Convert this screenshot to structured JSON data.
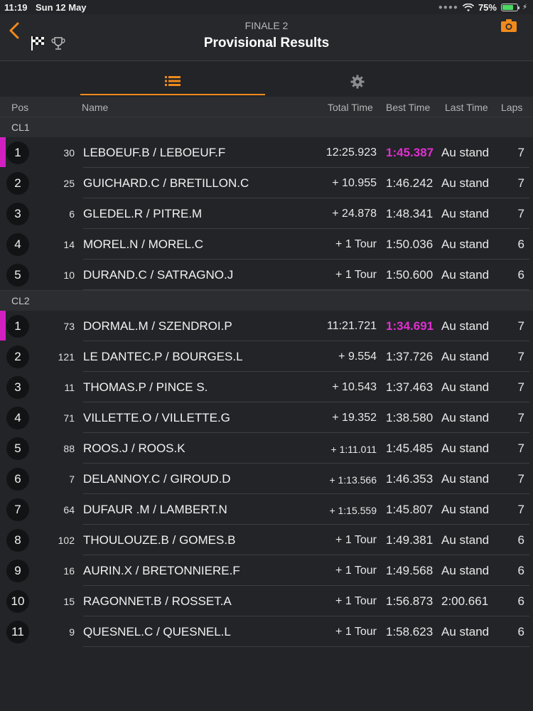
{
  "status": {
    "time": "11:19",
    "date": "Sun 12 May",
    "battery": "75%",
    "battery_level": 0.75
  },
  "header": {
    "subtitle": "FINALE 2",
    "title": "Provisional Results"
  },
  "columns": {
    "pos": "Pos",
    "name": "Name",
    "total": "Total Time",
    "best": "Best Time",
    "last": "Last Time",
    "laps": "Laps"
  },
  "colors": {
    "accent": "#f08a1c",
    "fastest": "#e02fd0",
    "leader_bar": "#d21fc0"
  },
  "classes": [
    {
      "label": "CL1",
      "rows": [
        {
          "pos": "1",
          "num": "30",
          "name": "LEBOEUF.B  / LEBOEUF.F",
          "total": "12:25.923",
          "best": "1:45.387",
          "last": "Au stand",
          "laps": "7",
          "fastest": true,
          "small": false
        },
        {
          "pos": "2",
          "num": "25",
          "name": "GUICHARD.C  / BRETILLON.C",
          "total": "+ 10.955",
          "best": "1:46.242",
          "last": "Au stand",
          "laps": "7",
          "fastest": false,
          "small": false
        },
        {
          "pos": "3",
          "num": "6",
          "name": "GLEDEL.R  / PITRE.M",
          "total": "+ 24.878",
          "best": "1:48.341",
          "last": "Au stand",
          "laps": "7",
          "fastest": false,
          "small": false
        },
        {
          "pos": "4",
          "num": "14",
          "name": "MOREL.N  / MOREL.C",
          "total": "+ 1 Tour",
          "best": "1:50.036",
          "last": "Au stand",
          "laps": "6",
          "fastest": false,
          "small": false
        },
        {
          "pos": "5",
          "num": "10",
          "name": "DURAND.C  / SATRAGNO.J",
          "total": "+ 1 Tour",
          "best": "1:50.600",
          "last": "Au stand",
          "laps": "6",
          "fastest": false,
          "small": false
        }
      ]
    },
    {
      "label": "CL2",
      "rows": [
        {
          "pos": "1",
          "num": "73",
          "name": "DORMAL.M  / SZENDROI.P",
          "total": "11:21.721",
          "best": "1:34.691",
          "last": "Au stand",
          "laps": "7",
          "fastest": true,
          "small": false
        },
        {
          "pos": "2",
          "num": "121",
          "name": "LE DANTEC.P  / BOURGES.L",
          "total": "+ 9.554",
          "best": "1:37.726",
          "last": "Au stand",
          "laps": "7",
          "fastest": false,
          "small": false
        },
        {
          "pos": "3",
          "num": "11",
          "name": "THOMAS.P  / PINCE S.",
          "total": "+ 10.543",
          "best": "1:37.463",
          "last": "Au stand",
          "laps": "7",
          "fastest": false,
          "small": false
        },
        {
          "pos": "4",
          "num": "71",
          "name": "VILLETTE.O  / VILLETTE.G",
          "total": "+ 19.352",
          "best": "1:38.580",
          "last": "Au stand",
          "laps": "7",
          "fastest": false,
          "small": false
        },
        {
          "pos": "5",
          "num": "88",
          "name": "ROOS.J  / ROOS.K",
          "total": "+ 1:11.011",
          "best": "1:45.485",
          "last": "Au stand",
          "laps": "7",
          "fastest": false,
          "small": true
        },
        {
          "pos": "6",
          "num": "7",
          "name": "DELANNOY.C  / GIROUD.D",
          "total": "+ 1:13.566",
          "best": "1:46.353",
          "last": "Au stand",
          "laps": "7",
          "fastest": false,
          "small": true
        },
        {
          "pos": "7",
          "num": "64",
          "name": "DUFAUR .M  / LAMBERT.N",
          "total": "+ 1:15.559",
          "best": "1:45.807",
          "last": "Au stand",
          "laps": "7",
          "fastest": false,
          "small": true
        },
        {
          "pos": "8",
          "num": "102",
          "name": "THOULOUZE.B  / GOMES.B",
          "total": "+ 1 Tour",
          "best": "1:49.381",
          "last": "Au stand",
          "laps": "6",
          "fastest": false,
          "small": false
        },
        {
          "pos": "9",
          "num": "16",
          "name": "AURIN.X  / BRETONNIERE.F",
          "total": "+ 1 Tour",
          "best": "1:49.568",
          "last": "Au stand",
          "laps": "6",
          "fastest": false,
          "small": false
        },
        {
          "pos": "10",
          "num": "15",
          "name": "RAGONNET.B  / ROSSET.A",
          "total": "+ 1 Tour",
          "best": "1:56.873",
          "last": "2:00.661",
          "laps": "6",
          "fastest": false,
          "small": false
        },
        {
          "pos": "11",
          "num": "9",
          "name": "QUESNEL.C  / QUESNEL.L",
          "total": "+ 1 Tour",
          "best": "1:58.623",
          "last": "Au stand",
          "laps": "6",
          "fastest": false,
          "small": false
        }
      ]
    }
  ]
}
